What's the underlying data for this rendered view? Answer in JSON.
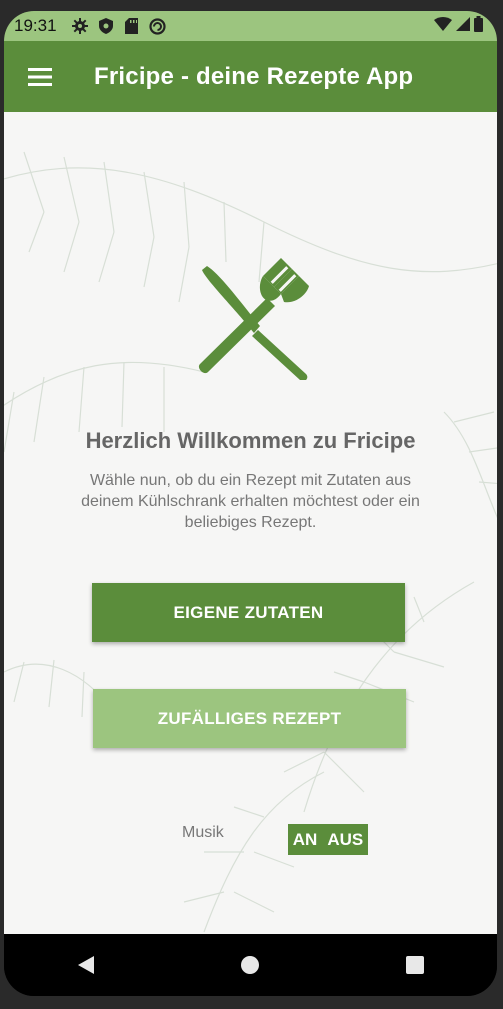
{
  "status_bar": {
    "time": "19:31",
    "icons": [
      "settings-icon",
      "shield-icon",
      "sd-card-icon",
      "sync-icon",
      "wifi-icon",
      "signal-icon",
      "battery-icon"
    ]
  },
  "app_bar": {
    "title": "Fricipe - deine Rezepte App",
    "color": "#5b8d3b"
  },
  "welcome": {
    "title": "Herzlich Willkommen zu Fricipe",
    "subtitle": "Wähle nun, ob du ein Rezept mit Zutaten aus deinem Kühlschrank erhalten möchtest oder ein beliebiges Rezept."
  },
  "buttons": {
    "own_ingredients": "EIGENE ZUTATEN",
    "random_recipe": "ZUFÄLLIGES REZEPT"
  },
  "music": {
    "label": "Musik",
    "on": "AN",
    "off": "AUS"
  },
  "colors": {
    "primary": "#5b8d3b",
    "light": "#9cc57f",
    "background": "#f6f6f5"
  }
}
